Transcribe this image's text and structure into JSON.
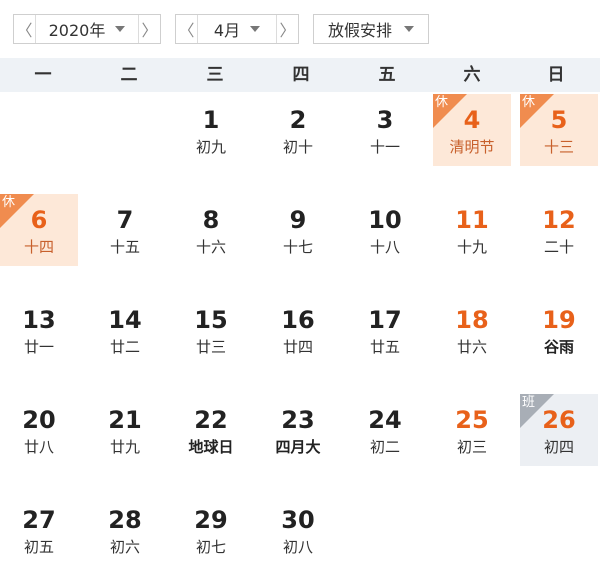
{
  "toolbar": {
    "year_label": "2020年",
    "month_label": "4月",
    "holiday_label": "放假安排",
    "prev_symbol": "〈",
    "next_symbol": "〉"
  },
  "weekdays": [
    "一",
    "二",
    "三",
    "四",
    "五",
    "六",
    "日"
  ],
  "days": [
    {
      "n": "1",
      "l": "初九"
    },
    {
      "n": "2",
      "l": "初十"
    },
    {
      "n": "3",
      "l": "十一"
    },
    {
      "n": "4",
      "l": "清明节",
      "badge": "休"
    },
    {
      "n": "5",
      "l": "十三",
      "badge": "休"
    },
    {
      "n": "6",
      "l": "十四",
      "badge": "休"
    },
    {
      "n": "7",
      "l": "十五"
    },
    {
      "n": "8",
      "l": "十六"
    },
    {
      "n": "9",
      "l": "十七"
    },
    {
      "n": "10",
      "l": "十八"
    },
    {
      "n": "11",
      "l": "十九"
    },
    {
      "n": "12",
      "l": "二十"
    },
    {
      "n": "13",
      "l": "廿一"
    },
    {
      "n": "14",
      "l": "廿二"
    },
    {
      "n": "15",
      "l": "廿三"
    },
    {
      "n": "16",
      "l": "廿四"
    },
    {
      "n": "17",
      "l": "廿五"
    },
    {
      "n": "18",
      "l": "廿六"
    },
    {
      "n": "19",
      "l": "谷雨"
    },
    {
      "n": "20",
      "l": "廿八"
    },
    {
      "n": "21",
      "l": "廿九"
    },
    {
      "n": "22",
      "l": "地球日"
    },
    {
      "n": "23",
      "l": "四月大"
    },
    {
      "n": "24",
      "l": "初二"
    },
    {
      "n": "25",
      "l": "初三"
    },
    {
      "n": "26",
      "l": "初四",
      "badge": "班"
    },
    {
      "n": "27",
      "l": "初五"
    },
    {
      "n": "28",
      "l": "初六"
    },
    {
      "n": "29",
      "l": "初七"
    },
    {
      "n": "30",
      "l": "初八"
    }
  ],
  "colors": {
    "weekend_number": "#e8611a",
    "rest_background": "#fde8d8",
    "rest_badge": "#f08c4f",
    "work_background": "#eceff3",
    "work_badge": "#a8aeb6",
    "header_background": "#eef2f6"
  }
}
